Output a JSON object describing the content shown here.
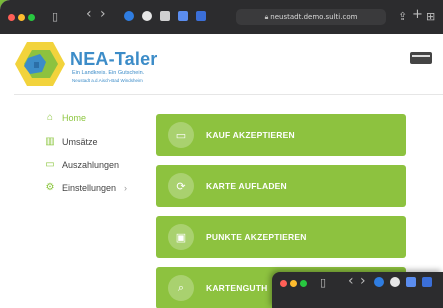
{
  "browser": {
    "url": "neustadt.demo.sulti.com",
    "back_glyph": "‹",
    "forward_glyph": "›",
    "sidebar_glyph": "▯",
    "share_glyph": "⇪",
    "newtab_glyph": "+",
    "tabs_glyph": "⊞"
  },
  "brand": {
    "name": "NEA-Taler",
    "tagline": "Ein Landkreis. Ein Gutschein.",
    "subtagline": "Neustadt a.d.Aisch-Bad Windsheim"
  },
  "sidebar": {
    "items": [
      {
        "label": "Home",
        "icon": "home-icon",
        "glyph": "⌂"
      },
      {
        "label": "Umsätze",
        "icon": "bar-chart-icon",
        "glyph": "▥"
      },
      {
        "label": "Auszahlungen",
        "icon": "wallet-icon",
        "glyph": "▭"
      },
      {
        "label": "Einstellungen",
        "icon": "gear-icon",
        "glyph": "⚙",
        "chevron": "›"
      }
    ]
  },
  "actions": [
    {
      "label": "KAUF AKZEPTIEREN",
      "icon": "card-icon",
      "glyph": "▭"
    },
    {
      "label": "KARTE AUFLADEN",
      "icon": "reload-icon",
      "glyph": "⟳"
    },
    {
      "label": "PUNKTE AKZEPTIEREN",
      "icon": "points-icon",
      "glyph": "▣"
    },
    {
      "label": "KARTENGUTH",
      "icon": "search-icon",
      "glyph": "⌕"
    }
  ],
  "colors": {
    "accent": "#8dc23f",
    "brand_blue": "#3c8cc8",
    "background": "#7dc13c"
  }
}
